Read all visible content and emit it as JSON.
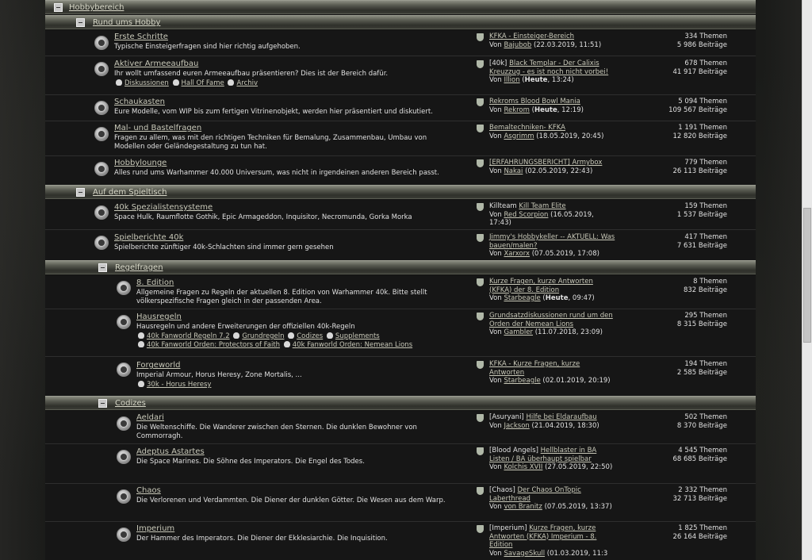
{
  "sections": [
    {
      "key": "hobbybereich",
      "title": "Hobbybereich"
    },
    {
      "key": "rund",
      "title": "Rund ums Hobby"
    },
    {
      "key": "spieltisch",
      "title": "Auf dem Spieltisch"
    },
    {
      "key": "regelfragen",
      "title": "Regelfragen"
    },
    {
      "key": "codizes",
      "title": "Codizes"
    }
  ],
  "forums": [
    {
      "name": "Erste Schritte",
      "desc": "Typische Einsteigerfragen sind hier richtig aufgehoben.",
      "subs": [],
      "prefix": "",
      "last_title": "KFKA - Einsteiger-Bereich",
      "last_by": "Von",
      "last_user": "Bajubob",
      "last_date": "(22.03.2019, 11:51)",
      "last_bold": "",
      "topics": "334 Themen",
      "posts": "5 986 Beiträge"
    },
    {
      "name": "Aktiver Armeeaufbau",
      "desc": "Ihr wollt umfassend euren Armeeaufbau präsentieren? Dies ist der Bereich dafür.",
      "subs": [
        "Diskussionen",
        "Hall Of Fame",
        "Archiv"
      ],
      "prefix": "[40k]",
      "last_title": "Black Templar - Der Calixis Kreuzzug - es ist noch nicht vorbei!",
      "last_by": "Von",
      "last_user": "Illion",
      "last_date": ", 13:24)",
      "last_bold": "Heute",
      "topics": "678 Themen",
      "posts": "41 917 Beiträge"
    },
    {
      "name": "Schaukasten",
      "desc": "Eure Modelle, vom WIP bis zum fertigen Vitrinenobjekt, werden hier präsentiert und diskutiert.",
      "subs": [],
      "prefix": "",
      "last_title": "Rekroms Blood Bowl Mania",
      "last_by": "Von",
      "last_user": "Rekrom",
      "last_date": ", 12:19)",
      "last_bold": "Heute",
      "topics": "5 094 Themen",
      "posts": "109 567 Beiträge"
    },
    {
      "name": "Mal- und Bastelfragen",
      "desc": "Fragen zu allem, was mit den richtigen Techniken für Bemalung, Zusammenbau, Umbau von Modellen oder Geländegestaltung zu tun hat.",
      "subs": [],
      "prefix": "",
      "last_title": "Bemaltechniken- KFKA",
      "last_by": "Von",
      "last_user": "Asgrimm",
      "last_date": "(18.05.2019, 20:45)",
      "last_bold": "",
      "topics": "1 191 Themen",
      "posts": "12 820 Beiträge"
    },
    {
      "name": "Hobbylounge",
      "desc": "Alles rund ums Warhammer 40.000 Universum, was nicht in irgendeinen anderen Bereich passt.",
      "subs": [],
      "prefix": "",
      "last_title": "[ERFAHRUNGSBERICHT] Armybox",
      "last_by": "Von",
      "last_user": "Nakai",
      "last_date": "(02.05.2019, 22:43)",
      "last_bold": "",
      "topics": "779 Themen",
      "posts": "26 113 Beiträge"
    },
    {
      "name": "40k Spezialistensysteme",
      "desc": "Space Hulk, Raumflotte Gothik, Epic Armageddon, Inquisitor, Necromunda, Gorka Morka",
      "subs": [],
      "prefix": "Killteam",
      "last_title": "Kill Team Elite",
      "last_by": "Von",
      "last_user": "Red Scorpion",
      "last_date": "(16.05.2019, 17:43)",
      "last_bold": "",
      "topics": "159 Themen",
      "posts": "1 537 Beiträge"
    },
    {
      "name": "Spielberichte 40k",
      "desc": "Spielberichte zünftiger 40k-Schlachten sind immer gern gesehen",
      "subs": [],
      "prefix": "",
      "last_title": "Jimmy's Hobbykeller -- AKTUELL: Was bauen/malen?",
      "last_by": "Von",
      "last_user": "Xarxorx",
      "last_date": "(07.05.2019, 17:08)",
      "last_bold": "",
      "topics": "417 Themen",
      "posts": "7 631 Beiträge"
    },
    {
      "name": "8. Edition",
      "desc": "Allgemeine Fragen zu Regeln der aktuellen 8. Edition von Warhammer 40k. Bitte stellt völkerspezifische Fragen gleich in der passenden Area.",
      "subs": [],
      "prefix": "",
      "last_title": "Kurze Fragen, kurze Antworten (KFKA) der 8. Edition",
      "last_by": "Von",
      "last_user": "Starbeagle",
      "last_date": ", 09:47)",
      "last_bold": "Heute",
      "topics": "8 Themen",
      "posts": "832 Beiträge"
    },
    {
      "name": "Hausregeln",
      "desc": "Hausregeln und andere Erweiterungen der offiziellen 40k-Regeln",
      "subs": [
        "40k Fanworld Regeln 7.2",
        "Grundregeln",
        "Codizes",
        "Supplements",
        "40k Fanworld Orden: Protectors of Faith",
        "40k Fanworld Orden: Nemean Lions"
      ],
      "prefix": "",
      "last_title": "Grundsatzdiskussionen rund um den Orden der Nemean Lions",
      "last_by": "Von",
      "last_user": "Gambler",
      "last_date": "(11.07.2018, 23:09)",
      "last_bold": "",
      "topics": "295 Themen",
      "posts": "8 315 Beiträge"
    },
    {
      "name": "Forgeworld",
      "desc": "Imperial Armour, Horus Heresy, Zone Mortalis, ...",
      "subs": [
        "30k - Horus Heresy"
      ],
      "prefix": "",
      "last_title": "KFKA - Kurze Fragen, kurze Antworten",
      "last_by": "Von",
      "last_user": "Starbeagle",
      "last_date": "(02.01.2019, 20:19)",
      "last_bold": "",
      "topics": "194 Themen",
      "posts": "2 585 Beiträge"
    },
    {
      "name": "Aeldari",
      "desc": "Die Weltenschiffe. Die Wanderer zwischen den Sternen. Die dunklen Bewohner von Commorragh.",
      "subs": [],
      "prefix": "[Asuryani]",
      "last_title": "Hilfe bei Eldaraufbau",
      "last_by": "Von",
      "last_user": "Jackson",
      "last_date": "(21.04.2019, 18:30)",
      "last_bold": "",
      "topics": "502 Themen",
      "posts": "8 370 Beiträge"
    },
    {
      "name": "Adeptus Astartes",
      "desc": "Die Space Marines. Die Söhne des Imperators. Die Engel des Todes.",
      "subs": [],
      "prefix": "[Blood Angels]",
      "last_title": "Hellblaster in BA Listen / BA überhaupt spielbar",
      "last_by": "Von",
      "last_user": "Kolchis XVII",
      "last_date": "(27.05.2019, 22:50)",
      "last_bold": "",
      "topics": "4 545 Themen",
      "posts": "68 685 Beiträge"
    },
    {
      "name": "Chaos",
      "desc": "Die Verlorenen und Verdammten. Die Diener der dunklen Götter. Die Wesen aus dem Warp.",
      "subs": [],
      "prefix": "[Chaos]",
      "last_title": "Der Chaos OnTopic Laberthread",
      "last_by": "Von",
      "last_user": "von Branitz",
      "last_date": "(07.05.2019, 13:37)",
      "last_bold": "",
      "topics": "2 332 Themen",
      "posts": "32 713 Beiträge"
    },
    {
      "name": "Imperium",
      "desc": "Der Hammer des Imperators. Die Diener der Ekklesiarchie. Die Inquisition.",
      "subs": [],
      "prefix": "[Imperium]",
      "last_title": "Kurze Fragen, kurze Antworten (KFKA) Imperium - 8. Edition",
      "last_by": "Von",
      "last_user": "SavageSkull",
      "last_date": "(01.03.2019, 11:3",
      "last_bold": "",
      "topics": "1 825 Themen",
      "posts": "26 164 Beiträge"
    }
  ]
}
